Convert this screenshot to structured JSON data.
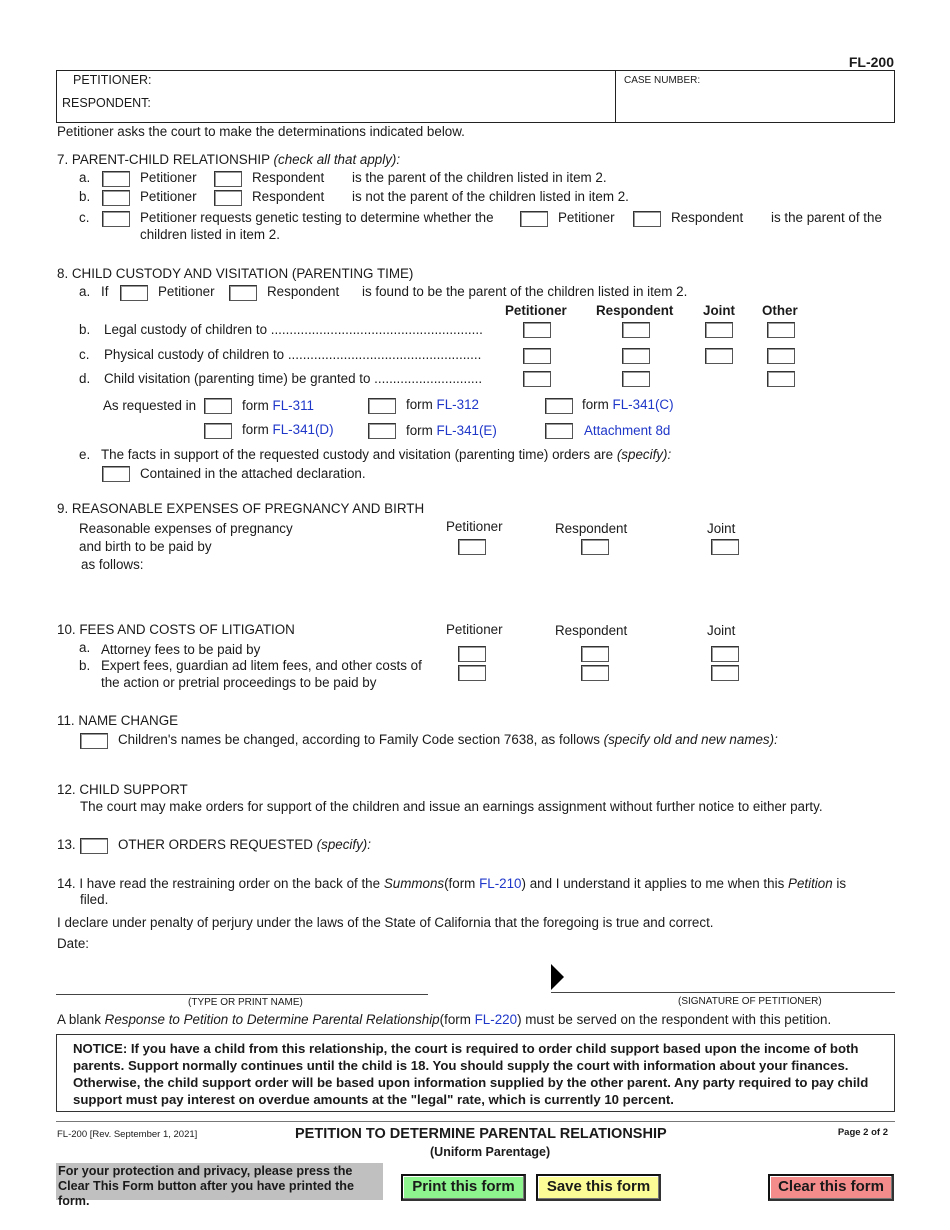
{
  "form_id": "FL-200",
  "caption": {
    "petitioner_label": "PETITIONER:",
    "respondent_label": "RESPONDENT:",
    "case_number_label": "CASE NUMBER:"
  },
  "intro": "Petitioner asks the court to make the determinations indicated below.",
  "item7": {
    "title": "7.  PARENT-CHILD RELATIONSHIP",
    "title_italic": "(check all that apply):",
    "a": {
      "letter": "a.",
      "opt1": "Petitioner",
      "opt2": "Respondent",
      "text": "is the parent of the children listed in item 2."
    },
    "b": {
      "letter": "b.",
      "opt1": "Petitioner",
      "opt2": "Respondent",
      "text": "is not the parent of the children listed in item 2."
    },
    "c": {
      "letter": "c.",
      "text1": "Petitioner requests genetic testing to determine whether the",
      "opt1": "Petitioner",
      "opt2": "Respondent",
      "text2": "is the parent of the",
      "text3": "children listed in item 2."
    }
  },
  "item8": {
    "title": "8.  CHILD CUSTODY AND VISITATION (PARENTING TIME)",
    "a": {
      "letter": "a.",
      "if": "If",
      "opt1": "Petitioner",
      "opt2": "Respondent",
      "text": "is found to be the parent of the children listed in item 2."
    },
    "columns": [
      "Petitioner",
      "Respondent",
      "Joint",
      "Other"
    ],
    "b": {
      "letter": "b.",
      "text": "Legal custody of children to ........................................................."
    },
    "c": {
      "letter": "c.",
      "text": "Physical custody of children to ...................................................."
    },
    "d": {
      "letter": "d.",
      "text": "Child visitation (parenting time) be granted to ............................."
    },
    "as_requested": "As requested in",
    "form_word": "form",
    "forms": [
      "FL-311",
      "FL-312",
      "FL-341(C)",
      "FL-341(D)",
      "FL-341(E)"
    ],
    "attachment": "Attachment 8d",
    "e": {
      "letter": "e.",
      "text": "The facts in support of the requested custody and visitation (parenting time) orders are",
      "italic": "(specify):",
      "checkbox_text": "Contained in the attached declaration."
    }
  },
  "item9": {
    "title": "9.  REASONABLE EXPENSES OF PREGNANCY AND BIRTH",
    "line1": "Reasonable expenses of pregnancy",
    "line2": "and birth to be paid by",
    "line3": "as follows:",
    "columns": [
      "Petitioner",
      "Respondent",
      "Joint"
    ]
  },
  "item10": {
    "title": "10. FEES AND COSTS OF LITIGATION",
    "columns": [
      "Petitioner",
      "Respondent",
      "Joint"
    ],
    "a": {
      "letter": "a.",
      "text": "Attorney fees to be paid by"
    },
    "b": {
      "letter": "b.",
      "text1": "Expert fees, guardian ad litem fees, and other costs of",
      "text2": "the action or pretrial proceedings to be paid by"
    }
  },
  "item11": {
    "title": "11. NAME CHANGE",
    "text": "Children's names be changed, according to Family Code section 7638, as follows",
    "italic": "(specify old and new names):"
  },
  "item12": {
    "title": "12. CHILD SUPPORT",
    "text": "The court may make orders for support of the children and issue an earnings assignment without further notice to either party."
  },
  "item13": {
    "number": "13.",
    "text": "OTHER ORDERS REQUESTED",
    "italic": "(specify):"
  },
  "item14": {
    "part1": "14. I have read the restraining order on the back of the",
    "summons": "Summons",
    "part2": "(form",
    "form": "FL-210",
    "part3": ") and I understand it applies to me when this",
    "petition": "Petition",
    "part4": "is",
    "part5": "filed."
  },
  "declaration": "I declare under penalty of perjury under the laws of the State of California that the foregoing is true and correct.",
  "date_label": "Date:",
  "name_caption": "(TYPE OR PRINT NAME)",
  "signature_caption": "(SIGNATURE OF PETITIONER)",
  "response_note": {
    "part1": "A blank",
    "italic": "Response to Petition to Determine Parental Relationship",
    "part2": "(form",
    "form": "FL-220",
    "part3": ") must be served on the respondent with this petition."
  },
  "notice": "NOTICE: If you have a child from this relationship, the court is required to order child support based upon the income of both parents. Support normally continues until the child is 18. You should supply the court with information about your finances. Otherwise, the child support order will be based upon information supplied by the other parent. Any party required to pay child support must pay interest on overdue amounts at the \"legal\" rate, which is currently 10 percent.",
  "footer": {
    "revision": "FL-200 [Rev. September 1, 2021]",
    "title": "PETITION TO DETERMINE PARENTAL RELATIONSHIP",
    "subtitle": "(Uniform Parentage)",
    "page": "Page 2 of 2"
  },
  "privacy_note": "For your protection and privacy, please press the Clear This Form button after you have printed the form.",
  "buttons": {
    "print": "Print this form",
    "save": "Save this form",
    "clear": "Clear this form"
  },
  "colors": {
    "link": "#1f37c9",
    "print_btn": "#8ef58e",
    "save_btn": "#fcfc96",
    "clear_btn": "#f58c8c",
    "privacy_bg": "#c0c0c0"
  }
}
